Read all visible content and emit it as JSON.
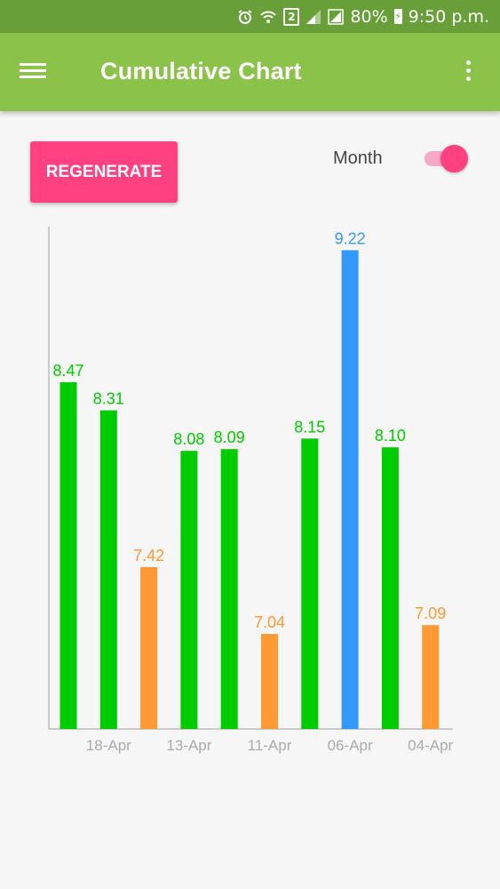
{
  "status_bar": {
    "sim_slot": "2",
    "battery": "80%",
    "time": "9:50 p.m.",
    "icons": [
      "alarm-icon",
      "wifi-icon",
      "sim-icon",
      "signal-icon",
      "signal-icon",
      "battery-charging-icon"
    ]
  },
  "toolbar": {
    "title": "Cumulative Chart",
    "menu_icon": "hamburger-menu-icon",
    "overflow_icon": "more-vert-icon"
  },
  "controls": {
    "regenerate_label": "REGENERATE",
    "switch_label": "Month",
    "switch_on": true
  },
  "colors": {
    "status_bar": "#689f38",
    "toolbar": "#8bc34a",
    "accent": "#ff4081",
    "bar_green": "#00cc00",
    "bar_orange": "#ff9933",
    "bar_blue": "#3399ff",
    "tick_label": "#aaaaaa"
  },
  "chart_data": {
    "type": "bar",
    "values": [
      8.47,
      8.31,
      7.42,
      8.08,
      8.09,
      7.04,
      8.15,
      9.22,
      8.1,
      7.09
    ],
    "value_labels": [
      "8.47",
      "8.31",
      "7.42",
      "8.08",
      "8.09",
      "7.04",
      "8.15",
      "9.22",
      "8.10",
      "7.09"
    ],
    "bar_colors": [
      "green",
      "green",
      "orange",
      "green",
      "green",
      "orange",
      "green",
      "blue",
      "green",
      "orange"
    ],
    "x_tick_labels": [
      {
        "bar_index": 1,
        "label": "18-Apr"
      },
      {
        "bar_index": 3,
        "label": "13-Apr"
      },
      {
        "bar_index": 5,
        "label": "11-Apr"
      },
      {
        "bar_index": 7,
        "label": "06-Apr"
      },
      {
        "bar_index": 9,
        "label": "04-Apr"
      }
    ],
    "ylim": [
      6.5,
      9.5
    ],
    "grid": false,
    "title": "",
    "xlabel": "",
    "ylabel": ""
  }
}
